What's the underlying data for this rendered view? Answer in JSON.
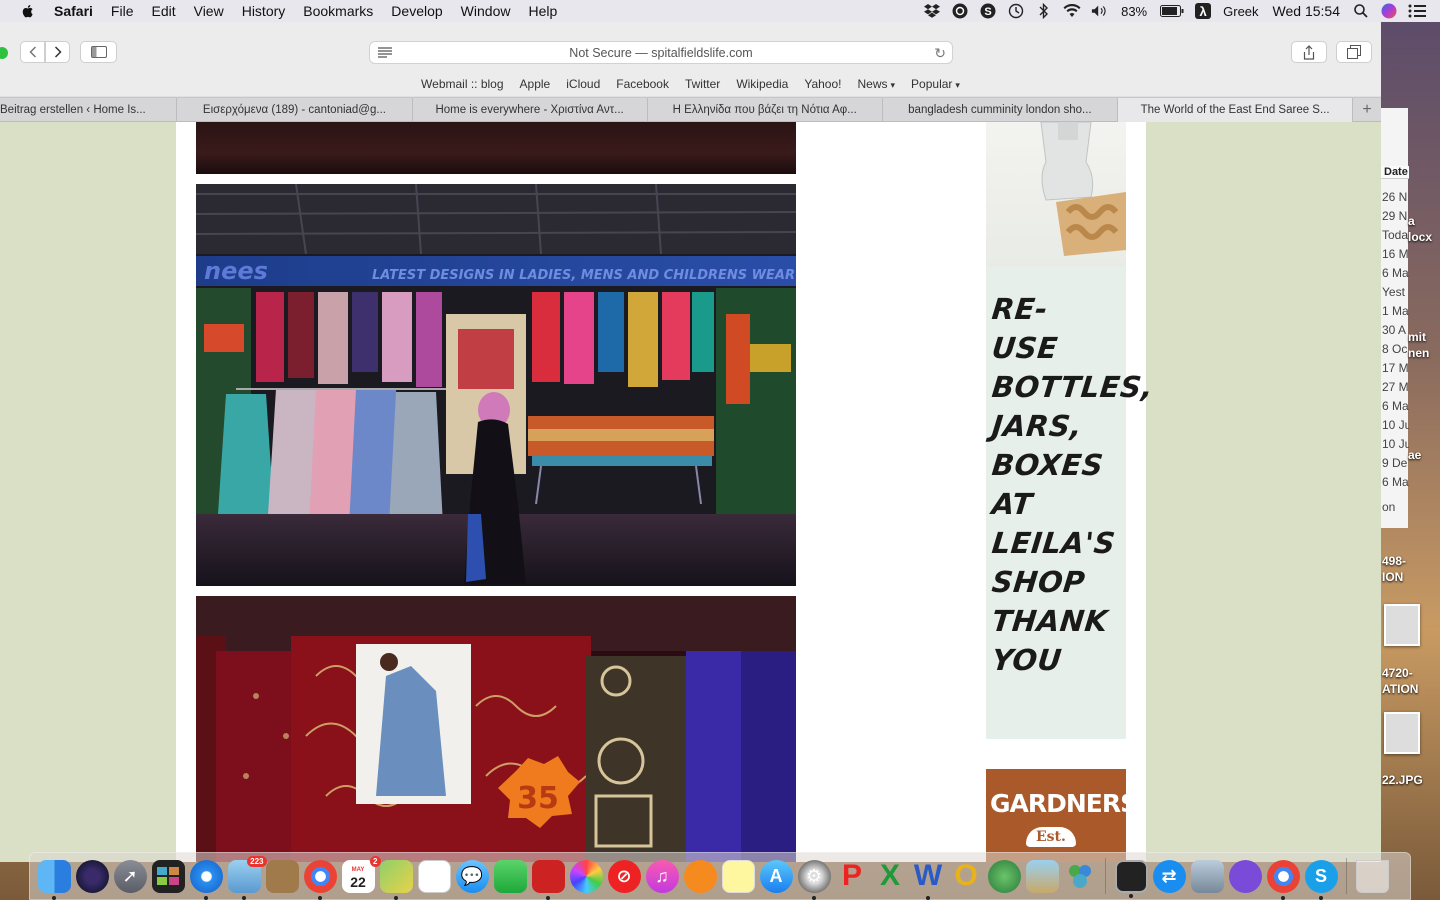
{
  "menubar": {
    "app_name": "Safari",
    "menus": [
      "File",
      "Edit",
      "View",
      "History",
      "Bookmarks",
      "Develop",
      "Window",
      "Help"
    ],
    "battery": "83%",
    "input_source": "Greek",
    "clock": "Wed 15:54"
  },
  "browser": {
    "url_text": "Not Secure — spitalfieldslife.com",
    "favorites": [
      "Webmail :: blog",
      "Apple",
      "iCloud",
      "Facebook",
      "Twitter",
      "Wikipedia",
      "Yahoo!",
      "News",
      "Popular"
    ],
    "tabs": [
      {
        "title": "Beitrag erstellen ‹ Home Is..."
      },
      {
        "title": "Εισερχόμενα (189) - cantoniad@g..."
      },
      {
        "title": "Home is everywhere - Χριστίνα Αντ..."
      },
      {
        "title": "Η Ελληνίδα που βάζει τη Νότια Αφ..."
      },
      {
        "title": "bangladesh cumminity london sho..."
      },
      {
        "title": "The World of the East End Saree S..."
      }
    ],
    "active_tab_index": 5
  },
  "page": {
    "shop_sign": "LATEST DESIGNS IN LADIES, MENS AND CHILDRENS WEAR",
    "shop_sign_left": "nees",
    "saree_price": "35",
    "ad_lines": [
      "RE-",
      "USE",
      "BOTTLES,",
      "JARS,",
      "BOXES",
      "AT",
      "LEILA'S",
      "SHOP",
      "THANK",
      "YOU"
    ],
    "gardners_title": "GARDNERS",
    "gardners_est": "Est."
  },
  "finder": {
    "header": "Date",
    "rows": [
      "26 N",
      "29 N",
      "Toda",
      "16 M",
      "6 Ma",
      "Yest",
      "1 Ma",
      "30 A",
      "8 Oc",
      "17 M",
      "27 M",
      "6 Ma",
      "10 Ju",
      "10 Ju",
      "9 De",
      "6 Ma",
      "on"
    ],
    "desktop_labels": [
      "a",
      "locx",
      "mit",
      "nen",
      "ae",
      "498-",
      "ION",
      "4720-",
      "ATION",
      "22.JPG"
    ]
  },
  "dock": {
    "mail_badge": "223",
    "calendar_month": "MAY",
    "calendar_day": "22",
    "calendar_badge": "2"
  },
  "colors": {
    "page_bg": "#dae0c5",
    "ad_bg": "#e7efeb",
    "gardners_brown": "#a9592a"
  }
}
